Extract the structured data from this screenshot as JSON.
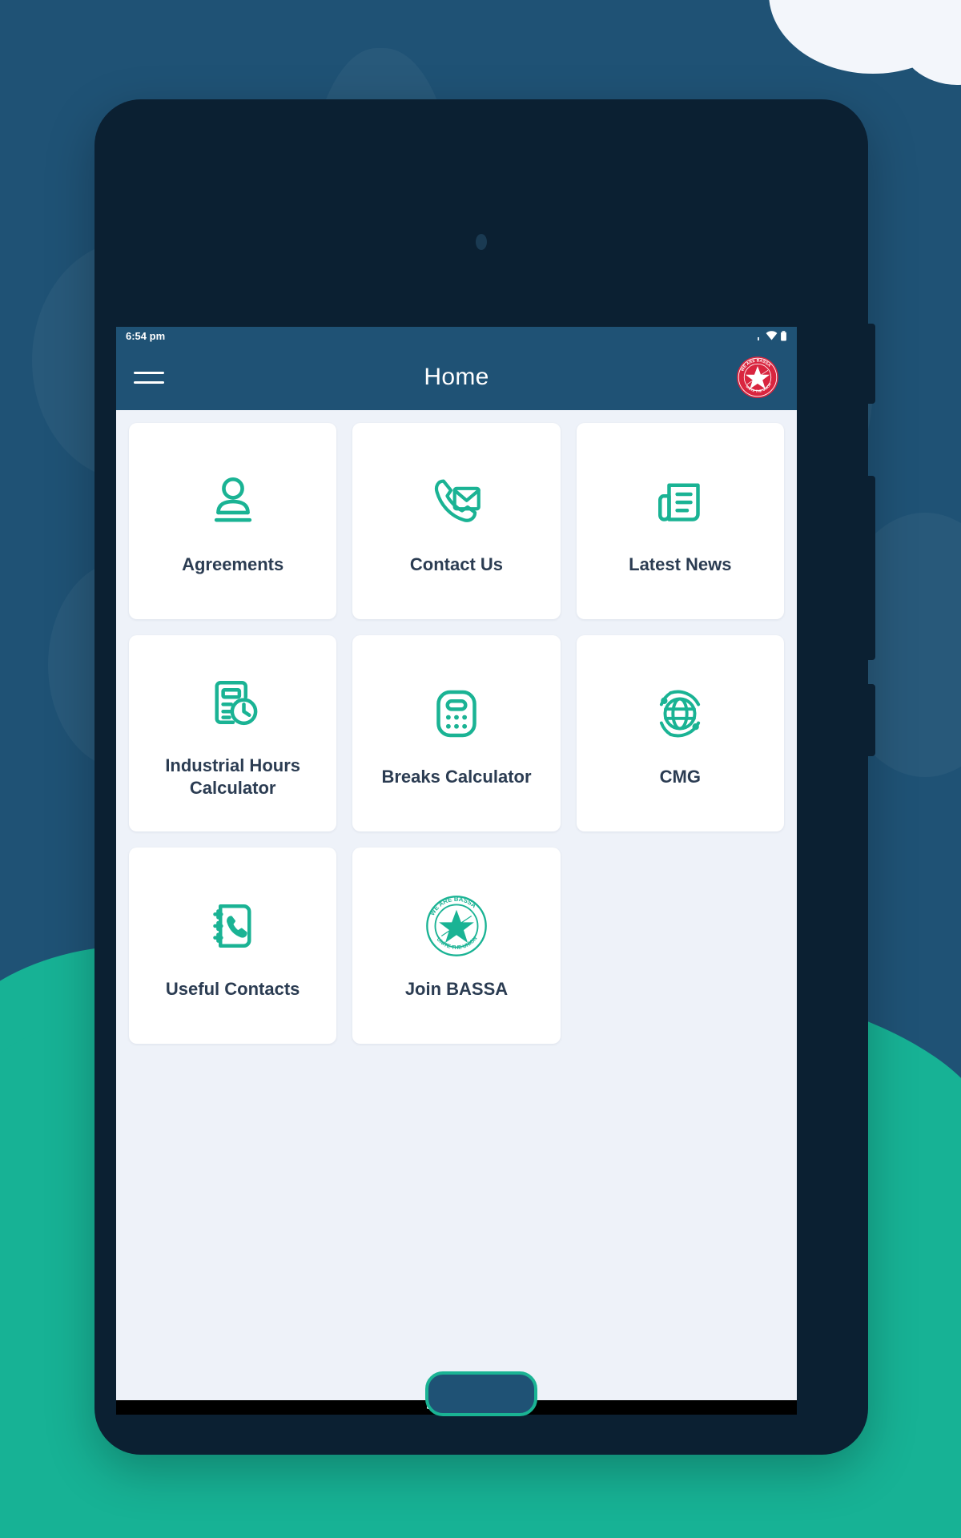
{
  "theme": {
    "background_blue": "#1f5275",
    "grass_green": "#17b295",
    "device_frame": "#0b2032",
    "screen_background": "#eef2f9",
    "appbar_blue": "#1f5275",
    "accent_teal": "#1ab394",
    "label_color": "#2b3c52",
    "logo_red": "#d9253f",
    "card_white": "#ffffff"
  },
  "statusbar": {
    "time": "6:54 pm",
    "icons": [
      "signal-icon",
      "wifi-icon",
      "battery-icon"
    ]
  },
  "appbar": {
    "menu_icon": "hamburger-menu-icon",
    "title": "Home",
    "logo": {
      "name": "bassa-logo-badge",
      "top_text": "WE ARE BASSA",
      "bottom_text": "UNITE THE UNION",
      "center": "star"
    }
  },
  "grid": {
    "items": [
      {
        "label": "Agreements",
        "icon": "person-podium-icon"
      },
      {
        "label": "Contact Us",
        "icon": "phone-envelope-icon"
      },
      {
        "label": "Latest News",
        "icon": "newspaper-icon"
      },
      {
        "label": "Industrial Hours Calculator",
        "icon": "calculator-clock-icon"
      },
      {
        "label": "Breaks Calculator",
        "icon": "calculator-icon"
      },
      {
        "label": "CMG",
        "icon": "globe-orbit-icon"
      },
      {
        "label": "Useful Contacts",
        "icon": "contact-book-phone-icon"
      },
      {
        "label": "Join BASSA",
        "icon": "bassa-seal-icon"
      }
    ]
  },
  "navbar": {
    "gesture_pill": "home-gesture-pill"
  },
  "device": {
    "camera": "front-camera-dot",
    "home_button": "physical-home-button",
    "side_buttons": [
      "volume-up-button",
      "volume-down-button",
      "power-button"
    ]
  }
}
